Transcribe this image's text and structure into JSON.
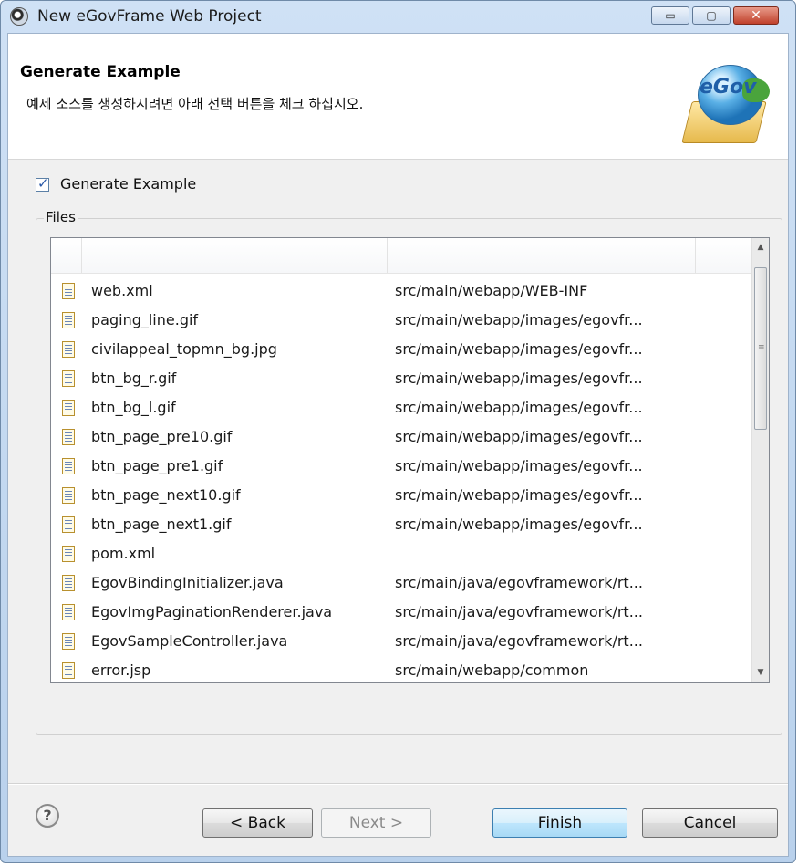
{
  "window": {
    "title": "New eGovFrame Web Project",
    "buttons": {
      "minimize": "▭",
      "maximize": "▢",
      "close": "✕"
    }
  },
  "banner": {
    "title": "Generate Example",
    "description": "예제 소스를 생성하시려면 아래 선택 버튼을 체크 하십시오.",
    "logo_text": "eGov"
  },
  "options": {
    "generate_example_label": "Generate Example",
    "generate_example_checked": true,
    "check_mark": "✓"
  },
  "files_group": {
    "label": "Files",
    "rows": [
      {
        "name": "web.xml",
        "path": "src/main/webapp/WEB-INF"
      },
      {
        "name": "paging_line.gif",
        "path": "src/main/webapp/images/egovfr..."
      },
      {
        "name": "civilappeal_topmn_bg.jpg",
        "path": "src/main/webapp/images/egovfr..."
      },
      {
        "name": "btn_bg_r.gif",
        "path": "src/main/webapp/images/egovfr..."
      },
      {
        "name": "btn_bg_l.gif",
        "path": "src/main/webapp/images/egovfr..."
      },
      {
        "name": "btn_page_pre10.gif",
        "path": "src/main/webapp/images/egovfr..."
      },
      {
        "name": "btn_page_pre1.gif",
        "path": "src/main/webapp/images/egovfr..."
      },
      {
        "name": "btn_page_next10.gif",
        "path": "src/main/webapp/images/egovfr..."
      },
      {
        "name": "btn_page_next1.gif",
        "path": "src/main/webapp/images/egovfr..."
      },
      {
        "name": "pom.xml",
        "path": ""
      },
      {
        "name": "EgovBindingInitializer.java",
        "path": "src/main/java/egovframework/rt..."
      },
      {
        "name": "EgovImgPaginationRenderer.java",
        "path": "src/main/java/egovframework/rt..."
      },
      {
        "name": "EgovSampleController.java",
        "path": "src/main/java/egovframework/rt..."
      },
      {
        "name": "error.jsp",
        "path": "src/main/webapp/common"
      }
    ],
    "scroll_up": "▲",
    "scroll_down": "▼",
    "scroll_grip": "≡"
  },
  "footer": {
    "help": "?",
    "back": "< Back",
    "next": "Next >",
    "finish": "Finish",
    "cancel": "Cancel"
  }
}
